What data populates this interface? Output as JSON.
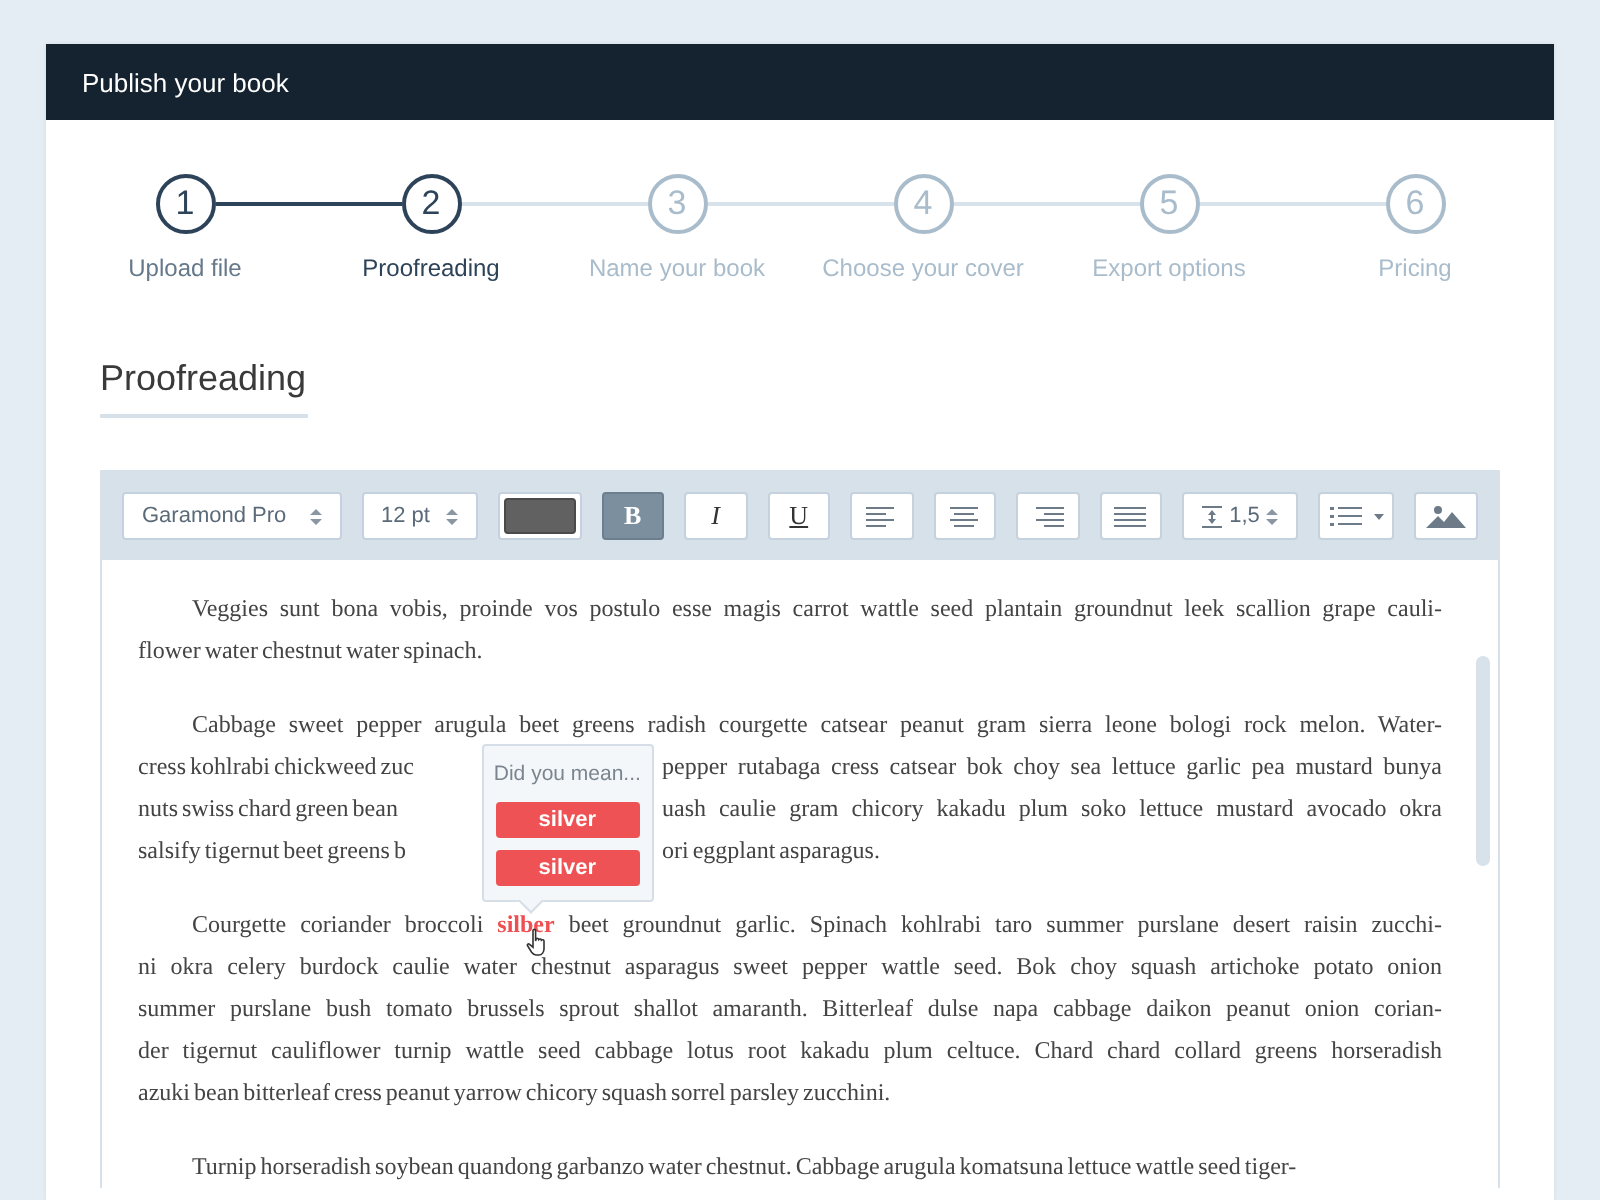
{
  "window": {
    "title": "Publish your book"
  },
  "steps": [
    {
      "number": "1",
      "label": "Upload file",
      "selected": false
    },
    {
      "number": "2",
      "label": "Proofreading",
      "selected": true
    },
    {
      "number": "3",
      "label": "Name your book",
      "selected": false
    },
    {
      "number": "4",
      "label": "Choose your cover",
      "selected": false
    },
    {
      "number": "5",
      "label": "Export options",
      "selected": false
    },
    {
      "number": "6",
      "label": "Pricing",
      "selected": false
    }
  ],
  "section": {
    "title": "Proofreading"
  },
  "toolbar": [
    {
      "kind": "select",
      "value": "Garamond Pro"
    },
    {
      "kind": "select",
      "value": "12 pt"
    },
    {
      "kind": "color",
      "color": "#616161"
    },
    {
      "kind": "bold",
      "label": "B",
      "on": true
    },
    {
      "kind": "italic",
      "label": "I",
      "on": false
    },
    {
      "kind": "underline",
      "label": "U",
      "on": false
    },
    {
      "kind": "leftalign"
    },
    {
      "kind": "centeralign"
    },
    {
      "kind": "rightalign"
    },
    {
      "kind": "justify"
    },
    {
      "kind": "spacing",
      "value": "1,5"
    },
    {
      "kind": "list"
    },
    {
      "kind": "image"
    }
  ],
  "document": {
    "paragraphs": [
      {
        "lines": [
          {
            "kind": "plain",
            "text": "Veggies sunt bona vobis, proinde vos postulo esse magis carrot wattle seed plantain groundnut leek scallion grape cauli-"
          },
          {
            "kind": "plain",
            "text": "flower water chestnut water spinach."
          }
        ]
      },
      {
        "lines": [
          {
            "kind": "plain",
            "text": "Cabbage sweet pepper arugula beet greens radish courgette catsear peanut gram sierra leone bologi rock melon. Water-"
          },
          {
            "kind": "split",
            "left": "cress kohlrabi chickweed zuc",
            "right": "pepper rutabaga cress catsear bok choy sea lettuce garlic pea mustard bunya"
          },
          {
            "kind": "split",
            "left": "nuts swiss chard green bean",
            "right": "uash caulie gram chicory kakadu plum soko lettuce mustard avocado okra"
          },
          {
            "kind": "split",
            "left": "salsify tigernut beet greens b",
            "right": "ori eggplant asparagus."
          }
        ]
      },
      {
        "lines": [
          {
            "kind": "marked",
            "before": "Courgette coriander broccoli",
            "word": "silber",
            "after": "beet groundnut garlic. Spinach kohlrabi taro summer purslane desert raisin zucchi-",
            "popup": {
              "title": "Did you mean...",
              "suggestions": [
                "silver",
                "silver"
              ]
            }
          },
          {
            "kind": "plain",
            "text": "ni okra celery burdock caulie water chestnut asparagus sweet pepper wattle seed. Bok choy squash artichoke potato onion"
          },
          {
            "kind": "plain",
            "text": "summer purslane bush tomato brussels sprout shallot amaranth. Bitterleaf dulse napa cabbage daikon peanut onion corian-"
          },
          {
            "kind": "plain",
            "text": "der tigernut cauliflower turnip wattle seed cabbage lotus root kakadu plum celtuce. Chard chard collard greens horseradish"
          },
          {
            "kind": "plain",
            "text": "azuki bean bitterleaf cress peanut yarrow chicory squash sorrel parsley zucchini."
          }
        ]
      },
      {
        "lines": [
          {
            "kind": "plain",
            "text": "Turnip horseradish soybean quandong garbanzo water chestnut. Cabbage arugula komatsuna lettuce wattle seed tiger-"
          }
        ]
      }
    ]
  }
}
